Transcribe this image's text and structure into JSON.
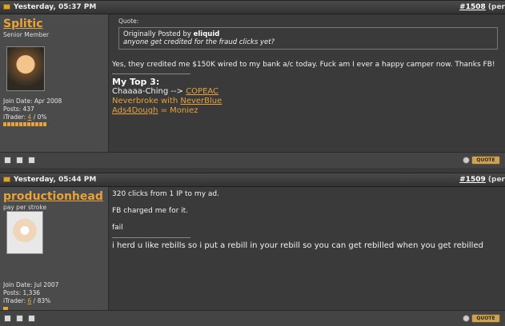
{
  "posts": [
    {
      "date": "Yesterday, 05:37 PM",
      "number": "#1508",
      "number_suffix": "(per",
      "username": "Splitic",
      "user_title": "Senior Member",
      "join_date": "Join Date: Apr 2008",
      "posts_count": "Posts: 437",
      "itrader_label": "iTrader:",
      "itrader_value": "4",
      "itrader_pct": "/ 0%",
      "quote_label": "Quote:",
      "quote_prefix": "Originally Posted by",
      "quote_author": "eliquid",
      "quote_text": "anyone get credited for the fraud clicks yet?",
      "body": "Yes, they credited me $150K wired to my bank a/c today. Fuck am I ever a happy camper now. Thanks FB!",
      "sig_title": "My Top 3:",
      "sig_line1_prefix": "Chaaaa-Ching -->",
      "sig_line1_link": "COPEAC",
      "sig_line2_prefix": "Neverbroke with",
      "sig_line2_link": "NeverBlue",
      "sig_line3_link": "Ads4Dough",
      "sig_line3_suffix": "= Moniez",
      "quote_button": "QUOTE"
    },
    {
      "date": "Yesterday, 05:44 PM",
      "number": "#1509",
      "number_suffix": "(per",
      "username": "productionhead",
      "user_title": "pay per stroke",
      "join_date": "Join Date: Jul 2007",
      "posts_count": "Posts: 1,336",
      "itrader_label": "iTrader:",
      "itrader_value": "6",
      "itrader_pct": "/ 83%",
      "lines": [
        "320 clicks from 1 IP to my ad.",
        "FB charged me for it.",
        "fail"
      ],
      "signature": "i herd u like rebills so i put a rebill in your rebill so you can get rebilled when you get rebilled",
      "quote_button": "QUOTE"
    }
  ]
}
